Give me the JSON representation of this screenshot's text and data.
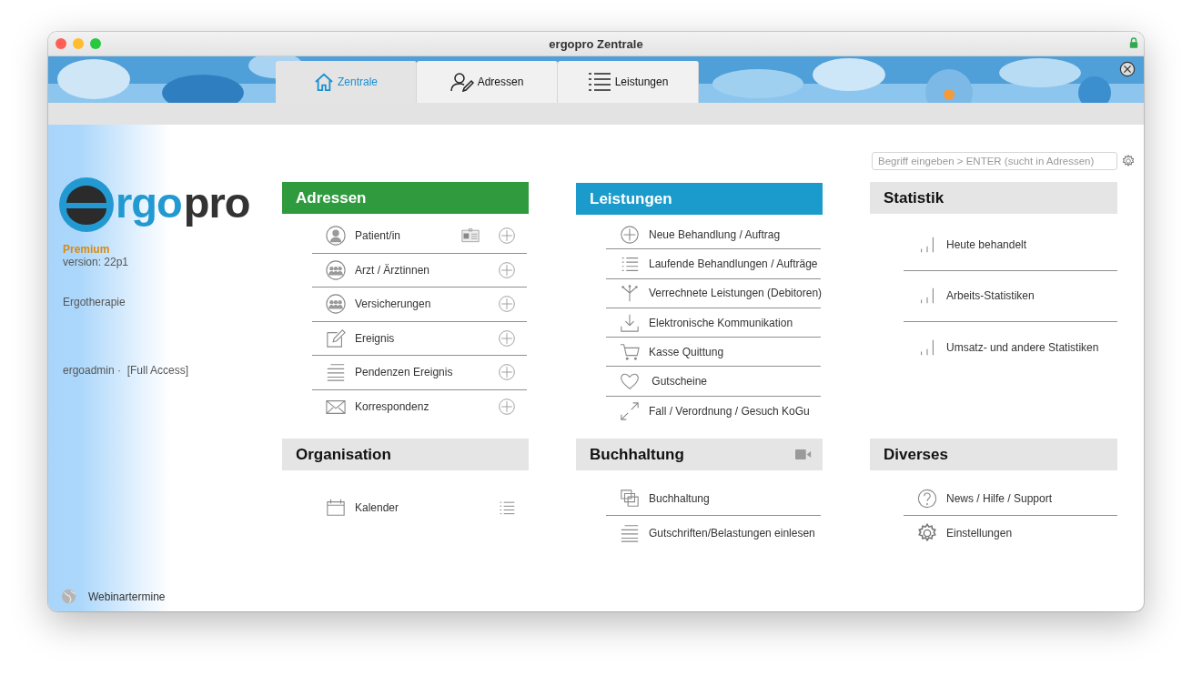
{
  "window": {
    "title": "ergopro Zentrale"
  },
  "tabs": [
    {
      "label": "Zentrale",
      "selected": true
    },
    {
      "label": "Adressen",
      "selected": false
    },
    {
      "label": "Leistungen",
      "selected": false
    }
  ],
  "sidebar": {
    "logo": [
      "rgo",
      "pro"
    ],
    "edition": "Premium",
    "version": "version: 22p1",
    "profession": "Ergotherapie",
    "user": "ergoadmin ·  [Full Access]",
    "footer_link": "Webinartermine"
  },
  "search": {
    "placeholder": "Begriff eingeben > ENTER (sucht in Adressen)"
  },
  "sections": [
    {
      "title": "Adressen",
      "color": "#2f9a3e",
      "items": [
        "Patient/in",
        "Arzt / Ärztinnen",
        "Versicherungen",
        "Ereignis",
        "Pendenzen Ereignis",
        "Korrespondenz"
      ]
    },
    {
      "title": "Leistungen",
      "color": "#1a9bcb",
      "items": [
        "Neue Behandlung / Auftrag",
        "Laufende Behandlungen / Aufträge",
        "Verrechnete Leistungen (Debitoren)",
        "Elektronische Kommunikation",
        "Kasse Quittung",
        " Gutscheine",
        "Fall / Verordnung / Gesuch KoGu"
      ]
    },
    {
      "title": "Statistik",
      "color": "#e5e5e5",
      "items": [
        "Heute behandelt",
        "Arbeits-Statistiken",
        "Umsatz- und andere Statistiken"
      ]
    },
    {
      "title": "Organisation",
      "color": "#e5e5e5",
      "items": [
        "Kalender"
      ]
    },
    {
      "title": "Buchhaltung",
      "color": "#e5e5e5",
      "items": [
        "Buchhaltung",
        "Gutschriften/Belastungen einlesen"
      ]
    },
    {
      "title": "Diverses",
      "color": "#e5e5e5",
      "items": [
        "News / Hilfe / Support",
        "Einstellungen"
      ]
    }
  ]
}
